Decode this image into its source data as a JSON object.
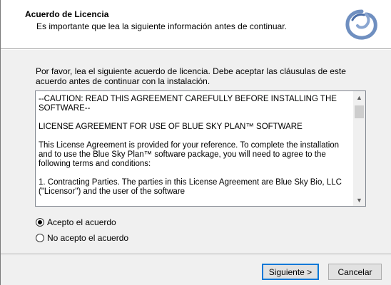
{
  "header": {
    "title": "Acuerdo de Licencia",
    "subtitle": "Es importante que lea la siguiente información antes de continuar.",
    "logo_icon": "setup-swirl-logo"
  },
  "intro": {
    "text": "Por favor, lea el siguiente acuerdo de licencia. Debe aceptar las cláusulas de este acuerdo antes de continuar con la instalación."
  },
  "license": {
    "lines": [
      "--CAUTION:  READ THIS AGREEMENT CAREFULLY BEFORE INSTALLING THE SOFTWARE--",
      "LICENSE AGREEMENT FOR USE OF BLUE SKY PLAN™ SOFTWARE",
      "This License Agreement is provided for your reference. To complete the installation and to use the Blue Sky Plan™ software package, you will need to agree to the following terms and conditions:",
      "1. Contracting Parties. The parties in this License Agreement are Blue Sky Bio, LLC (\"Licensor\") and the user of the software"
    ]
  },
  "options": {
    "accept": "Acepto el acuerdo",
    "reject": "No acepto el acuerdo",
    "selected": "accept"
  },
  "buttons": {
    "next": "Siguiente >",
    "cancel": "Cancelar"
  },
  "colors": {
    "accent": "#0078d7",
    "logo": "#6f8fc0"
  }
}
